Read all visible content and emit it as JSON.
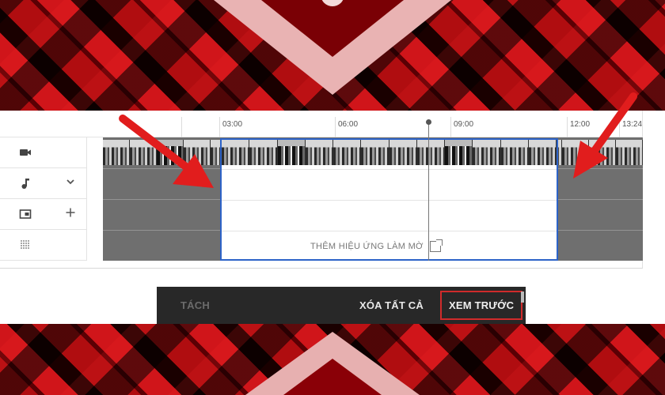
{
  "ruler": {
    "ticks": [
      "03:00",
      "06:00",
      "09:00",
      "12:00",
      "13:24"
    ]
  },
  "lanes": [
    {
      "icon": "video-icon",
      "action": ""
    },
    {
      "icon": "music-note-icon",
      "action": "chevron-down-icon"
    },
    {
      "icon": "picture-in-picture-icon",
      "action": "plus-icon"
    },
    {
      "icon": "blur-grid-icon",
      "action": ""
    }
  ],
  "selection": {
    "blur_label": "THÊM HIỆU ỨNG LÀM MỜ"
  },
  "toolbar": {
    "split_label": "TÁCH",
    "clear_all_label": "XÓA TẤT CẢ",
    "preview_label": "XEM TRƯỚC"
  },
  "colors": {
    "selection_border": "#2d63c8",
    "highlight_red": "#d02b2b",
    "arrow_red": "#e11d1d",
    "toolbar_bg": "#282828"
  }
}
